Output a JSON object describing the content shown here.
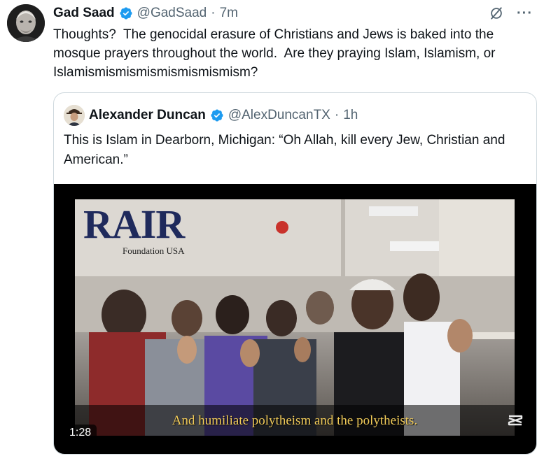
{
  "tweet": {
    "author_name": "Gad Saad",
    "handle": "@GadSaad",
    "separator": "·",
    "time": "7m",
    "text": "Thoughts?  The genocidal erasure of Christians and Jews is baked into the mosque prayers throughout the world.  Are they praying Islam, Islamism, or Islamismismismismismismismism?",
    "more_label": "···"
  },
  "quote": {
    "author_name": "Alexander Duncan",
    "handle": "@AlexDuncanTX",
    "separator": "·",
    "time": "1h",
    "text": "This is Islam in Dearborn, Michigan: “Oh Allah, kill every Jew, Christian and American.”"
  },
  "video": {
    "logo_word": "RAIR",
    "logo_sub": "Foundation USA",
    "subtitle": "And humiliate polytheism and the polytheists.",
    "duration": "1:28"
  },
  "colors": {
    "verified_blue": "#1d9bf0",
    "secondary_text": "#536471",
    "border": "#cfd9de",
    "subtitle_yellow": "#f2cc5a"
  },
  "icons": [
    "verified-badge-icon",
    "grok-icon",
    "more-icon",
    "capcut-icon"
  ]
}
